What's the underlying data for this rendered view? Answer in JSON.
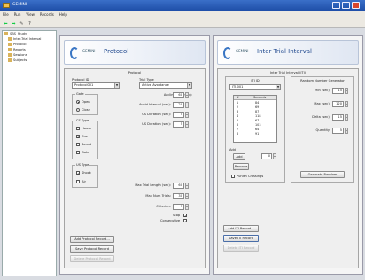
{
  "window": {
    "title": "GEMINI"
  },
  "menu": [
    "File",
    "Run",
    "View",
    "Records",
    "Help"
  ],
  "tree": {
    "root": "SBS_Study",
    "children": [
      "Inter-Trial Interval",
      "Protocol",
      "Reports",
      "Sessions",
      "Subjects"
    ]
  },
  "protocol": {
    "brand": "GEMINI",
    "title": "Protocol",
    "section_title": "Protocol",
    "protocol_id_label": "Protocol ID",
    "protocol_id_value": "Protocol001",
    "gate_label": "Gate",
    "gate_open": "Open",
    "gate_close": "Close",
    "cs_type_label": "CS Type",
    "cs_options": [
      "House",
      "Cue",
      "Sound",
      "Gate"
    ],
    "us_type_label": "US Type",
    "us_options": [
      "Shock",
      "Air"
    ],
    "trial_type_label": "Trial Type",
    "trial_type_value": "Active Avoidance",
    "fields": [
      {
        "label": "Acclimation (sec):",
        "value": "60"
      },
      {
        "label": "Avoid Interval (sec):",
        "value": "20"
      },
      {
        "label": "CS Duration (sec):",
        "value": "5"
      },
      {
        "label": "US Duration (sec):",
        "value": "5"
      }
    ],
    "fields2": [
      {
        "label": "Max Trial Length (sec):",
        "value": "60"
      },
      {
        "label": "Max Num Trials:",
        "value": "30"
      },
      {
        "label": "Criterion:",
        "value": "3"
      }
    ],
    "stop_label": "Stop",
    "consecutive_label": "Consecutive",
    "buttons": {
      "add": "Add Protocol Record...",
      "save": "Save Protocol Record",
      "delete": "Delete Protocol Record"
    }
  },
  "iti": {
    "brand": "GEMINI",
    "title": "Inter Trial Interval",
    "section_title": "Inter Trial Interval (ITI)",
    "iti_label": "ITI ID",
    "iti_value": "ITI-001",
    "table_headers": [
      "#",
      "Seconds"
    ],
    "table_rows": [
      {
        "n": "1",
        "s": "84"
      },
      {
        "n": "2",
        "s": "69"
      },
      {
        "n": "3",
        "s": "87"
      },
      {
        "n": "4",
        "s": "118"
      },
      {
        "n": "5",
        "s": "67"
      },
      {
        "n": "6",
        "s": "103"
      },
      {
        "n": "7",
        "s": "64"
      },
      {
        "n": "8",
        "s": "91"
      }
    ],
    "add_label": "Add",
    "add_value": "0",
    "remove_label": "Remove",
    "punish_label": "Punish Crossings",
    "rng": {
      "title": "Random Number Generator",
      "fields": [
        {
          "label": "Min (sec):",
          "value": "15"
        },
        {
          "label": "Max (sec):",
          "value": "120"
        },
        {
          "label": "Delta (sec):",
          "value": "15"
        },
        {
          "label": "Quantity:",
          "value": "5"
        }
      ],
      "generate": "Generate Random"
    },
    "buttons": {
      "add": "Add ITI Record...",
      "save": "Save ITI Record",
      "delete": "Delete ITI Record"
    }
  }
}
